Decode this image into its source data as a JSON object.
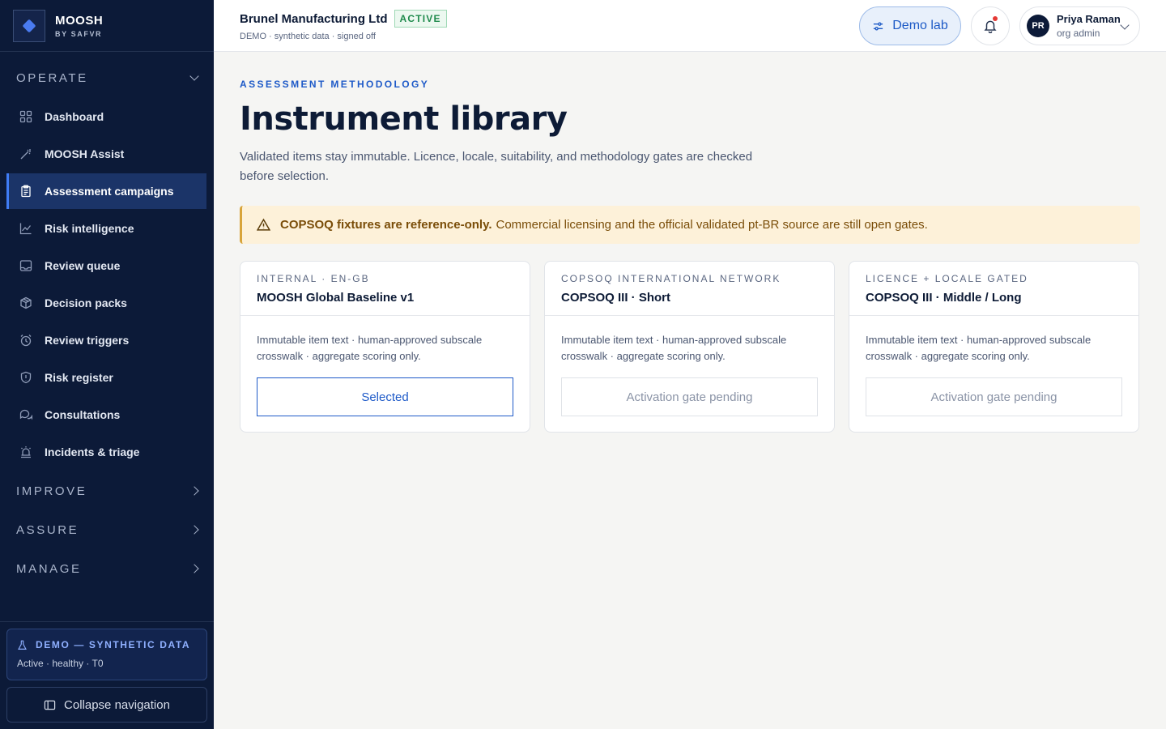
{
  "brand": {
    "name": "MOOSH",
    "sub": "BY SAFVR",
    "logo_icon": "hexagon-logo-icon"
  },
  "sidebar": {
    "sections": [
      {
        "label": "OPERATE",
        "expanded": true
      },
      {
        "label": "IMPROVE",
        "expanded": false
      },
      {
        "label": "ASSURE",
        "expanded": false
      },
      {
        "label": "MANAGE",
        "expanded": false
      }
    ],
    "items": [
      {
        "label": "Dashboard",
        "icon": "grid-icon",
        "active": false
      },
      {
        "label": "MOOSH Assist",
        "icon": "wand-icon",
        "active": false
      },
      {
        "label": "Assessment campaigns",
        "icon": "clipboard-icon",
        "active": true
      },
      {
        "label": "Risk intelligence",
        "icon": "chart-line-icon",
        "active": false
      },
      {
        "label": "Review queue",
        "icon": "inbox-icon",
        "active": false
      },
      {
        "label": "Decision packs",
        "icon": "package-icon",
        "active": false
      },
      {
        "label": "Review triggers",
        "icon": "alarm-clock-icon",
        "active": false
      },
      {
        "label": "Risk register",
        "icon": "shield-icon",
        "active": false
      },
      {
        "label": "Consultations",
        "icon": "chat-bubbles-icon",
        "active": false
      },
      {
        "label": "Incidents & triage",
        "icon": "siren-icon",
        "active": false
      }
    ],
    "footer": {
      "demo_title": "DEMO — SYNTHETIC DATA",
      "demo_status": "Active · healthy · T0",
      "collapse_label": "Collapse navigation"
    }
  },
  "topbar": {
    "org_name": "Brunel Manufacturing Ltd",
    "org_status": "ACTIVE",
    "org_meta": "DEMO · synthetic data · signed off",
    "demo_lab_label": "Demo lab",
    "user": {
      "initials": "PR",
      "name": "Priya Raman",
      "role": "org admin"
    }
  },
  "main": {
    "eyebrow": "ASSESSMENT METHODOLOGY",
    "title": "Instrument library",
    "lede": "Validated items stay immutable. Licence, locale, suitability, and methodology gates are checked before selection.",
    "alert": {
      "strong": "COPSOQ fixtures are reference-only.",
      "text": "Commercial licensing and the official validated pt-BR source are still open gates."
    },
    "cards": [
      {
        "kicker": "INTERNAL · EN-GB",
        "name": "MOOSH Global Baseline v1",
        "desc": "Immutable item text · human-approved subscale crosswalk · aggregate scoring only.",
        "action": "Selected",
        "state": "selected"
      },
      {
        "kicker": "COPSOQ INTERNATIONAL NETWORK",
        "name": "COPSOQ III · Short",
        "desc": "Immutable item text · human-approved subscale crosswalk · aggregate scoring only.",
        "action": "Activation gate pending",
        "state": "pending"
      },
      {
        "kicker": "LICENCE + LOCALE GATED",
        "name": "COPSOQ III · Middle / Long",
        "desc": "Immutable item text · human-approved subscale crosswalk · aggregate scoring only.",
        "action": "Activation gate pending",
        "state": "pending"
      }
    ]
  },
  "colors": {
    "sidebar_bg": "#0c1a38",
    "accent": "#1e5ac8",
    "active_badge": "#1f8a4c",
    "alert_bg": "#fdf1d9"
  }
}
